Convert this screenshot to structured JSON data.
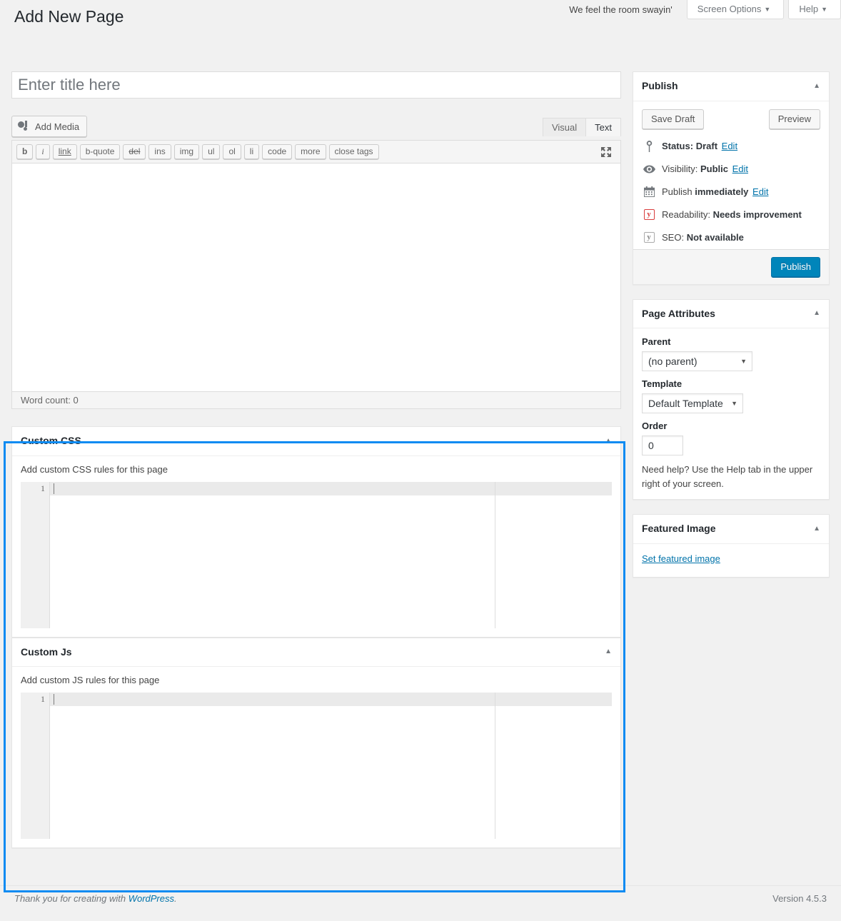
{
  "topbar": {
    "greeting": "We feel the room swayin'",
    "screen_options_label": "Screen Options",
    "help_label": "Help",
    "caret": "▼"
  },
  "page": {
    "title": "Add New Page"
  },
  "title_field": {
    "placeholder": "Enter title here",
    "value": ""
  },
  "editor": {
    "add_media_label": "Add Media",
    "tabs": [
      {
        "label": "Visual",
        "active": false
      },
      {
        "label": "Text",
        "active": true
      }
    ],
    "quicktags": [
      "b",
      "i",
      "link",
      "b-quote",
      "del",
      "ins",
      "img",
      "ul",
      "ol",
      "li",
      "code",
      "more",
      "close tags"
    ],
    "content": "",
    "statusbar": "Word count: 0"
  },
  "custom_css": {
    "title": "Custom CSS",
    "description": "Add custom CSS rules for this page",
    "line_number": "1",
    "code": ""
  },
  "custom_js": {
    "title": "Custom Js",
    "description": "Add custom JS rules for this page",
    "line_number": "1",
    "code": ""
  },
  "publish_box": {
    "title": "Publish",
    "save_draft_label": "Save Draft",
    "preview_label": "Preview",
    "publish_label": "Publish",
    "status": {
      "label": "Status:",
      "value": "Draft",
      "edit": "Edit"
    },
    "visibility": {
      "label": "Visibility:",
      "value": "Public",
      "edit": "Edit"
    },
    "schedule": {
      "label": "Publish",
      "value": "immediately",
      "edit": "Edit"
    },
    "readability": {
      "label": "Readability:",
      "value": "Needs improvement"
    },
    "seo": {
      "label": "SEO:",
      "value": "Not available"
    }
  },
  "page_attributes": {
    "title": "Page Attributes",
    "parent_label": "Parent",
    "parent_value": "(no parent)",
    "template_label": "Template",
    "template_value": "Default Template",
    "order_label": "Order",
    "order_value": "0",
    "help_text": "Need help? Use the Help tab in the upper right of your screen."
  },
  "featured_image": {
    "title": "Featured Image",
    "link_label": "Set featured image"
  },
  "footer": {
    "thanks_prefix": "Thank you for creating with ",
    "wordpress_label": "WordPress",
    "thanks_suffix": ".",
    "version": "Version 4.5.3"
  },
  "icons": {
    "collapse": "▲",
    "select_caret": "▼"
  },
  "colors": {
    "accent_blue": "#0085ba",
    "highlight_blue": "#0d8bf2",
    "link_blue": "#0073aa"
  }
}
